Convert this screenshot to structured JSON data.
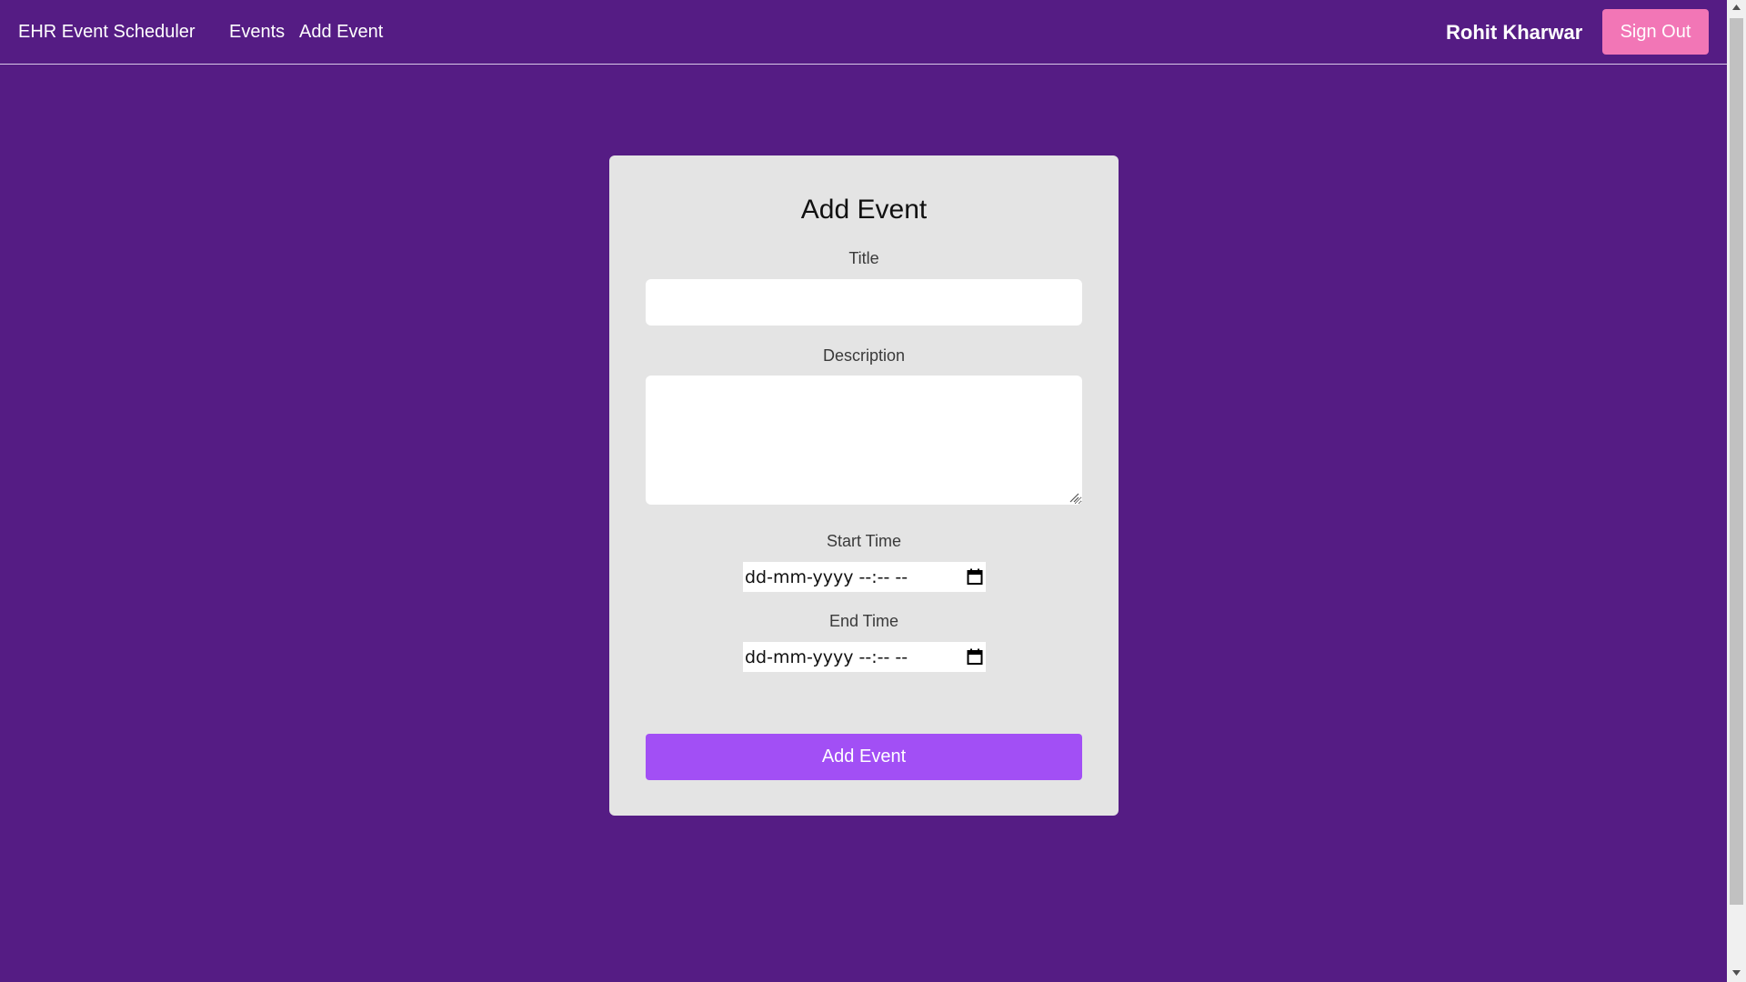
{
  "navbar": {
    "brand": "EHR Event Scheduler",
    "links": [
      {
        "label": "Events"
      },
      {
        "label": "Add Event"
      }
    ],
    "user_name": "Rohit Kharwar",
    "signout_label": "Sign Out"
  },
  "form": {
    "heading": "Add Event",
    "title_label": "Title",
    "title_value": "",
    "description_label": "Description",
    "description_value": "",
    "start_label": "Start Time",
    "start_value": "dd-mm-yyyy --:-- --",
    "end_label": "End Time",
    "end_value": "dd-mm-yyyy --:-- --",
    "submit_label": "Add Event"
  },
  "colors": {
    "background": "#551c84",
    "card": "#e4e4e4",
    "signout": "#f276b6",
    "submit": "#a24ff5"
  },
  "icons": [
    "calendar-icon",
    "resize-grip-icon",
    "scroll-up-arrow-icon",
    "scroll-down-arrow-icon"
  ]
}
